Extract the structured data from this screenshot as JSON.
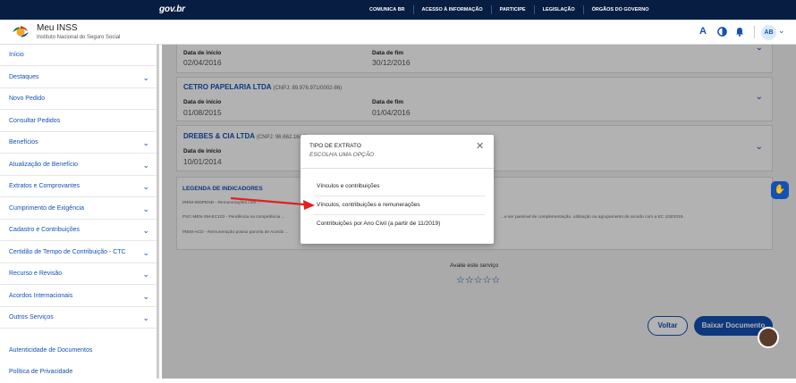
{
  "gov": {
    "logo": "gov.br",
    "links": [
      "COMUNICA BR",
      "ACESSO À INFORMAÇÃO",
      "PARTICIPE",
      "LEGISLAÇÃO",
      "ÓRGÃOS DO GOVERNO"
    ]
  },
  "header": {
    "title": "Meu INSS",
    "subtitle": "Instituto Nacional do Seguro Social",
    "font_size_icon": "A",
    "avatar_initials": "AB"
  },
  "sidebar": {
    "items": [
      {
        "label": "Início",
        "chevron": false
      },
      {
        "label": "Destaques",
        "chevron": true
      },
      {
        "label": "Novo Pedido",
        "chevron": false
      },
      {
        "label": "Consultar Pedidos",
        "chevron": false
      },
      {
        "label": "Benefícios",
        "chevron": true
      },
      {
        "label": "Atualização de Benefício",
        "chevron": true
      },
      {
        "label": "Extratos e Comprovantes",
        "chevron": true
      },
      {
        "label": "Cumprimento de Exigência",
        "chevron": true
      },
      {
        "label": "Cadastro e Contribuições",
        "chevron": true
      },
      {
        "label": "Certidão de Tempo de Contribuição - CTC",
        "chevron": true
      },
      {
        "label": "Recurso e Revisão",
        "chevron": true
      },
      {
        "label": "Acordos Internacionais",
        "chevron": true
      },
      {
        "label": "Outros Serviços",
        "chevron": true
      }
    ],
    "bottom": [
      "Autenticidade de Documentos",
      "Política de Privacidade"
    ]
  },
  "cards": [
    {
      "name": "",
      "cnpj": "",
      "start_label": "Data de início",
      "start": "02/04/2016",
      "end_label": "Data de fim",
      "end": "30/12/2016"
    },
    {
      "name": "CETRO PAPELARIA LTDA",
      "cnpj": "(CNPJ: 89.976.971/0002-86)",
      "start_label": "Data de início",
      "start": "01/08/2015",
      "end_label": "Data de fim",
      "end": "01/04/2016"
    },
    {
      "name": "DREBES & CIA LTDA",
      "cnpj": "(CNPJ: 96.662.168/0...",
      "start_label": "Data de início",
      "start": "10/01/2014",
      "end_label": "",
      "end": ""
    }
  ],
  "legend": {
    "title": "LEGENDA DE INDICADORES",
    "lines": [
      "IREM-INDPEND - Remunerações com ...",
      "PSC-MEN-SM-EC103 - Pendência na competência ...",
      "IREM-ACD - Remuneração possui parcela de Acordo ..."
    ],
    "line_right": "...e ser passível de complementação, utilização ou agrupamento de acordo com a EC 103/2019."
  },
  "rating": {
    "label": "Avalie este serviço",
    "stars": "☆☆☆☆☆"
  },
  "buttons": {
    "back": "Voltar",
    "download": "Baixar Documento"
  },
  "modal": {
    "title": "TIPO DE EXTRATO",
    "subtitle": "ESCOLHA UMA OPÇÃO",
    "options": [
      "Vínculos e contribuições",
      "Vínculos, contribuições e remunerações",
      "Contribuições por Ano Civil (a partir de 11/2019)"
    ]
  },
  "colors": {
    "gov_bar": "#071d41",
    "primary": "#1351b4",
    "annotation_arrow": "#e02020"
  }
}
